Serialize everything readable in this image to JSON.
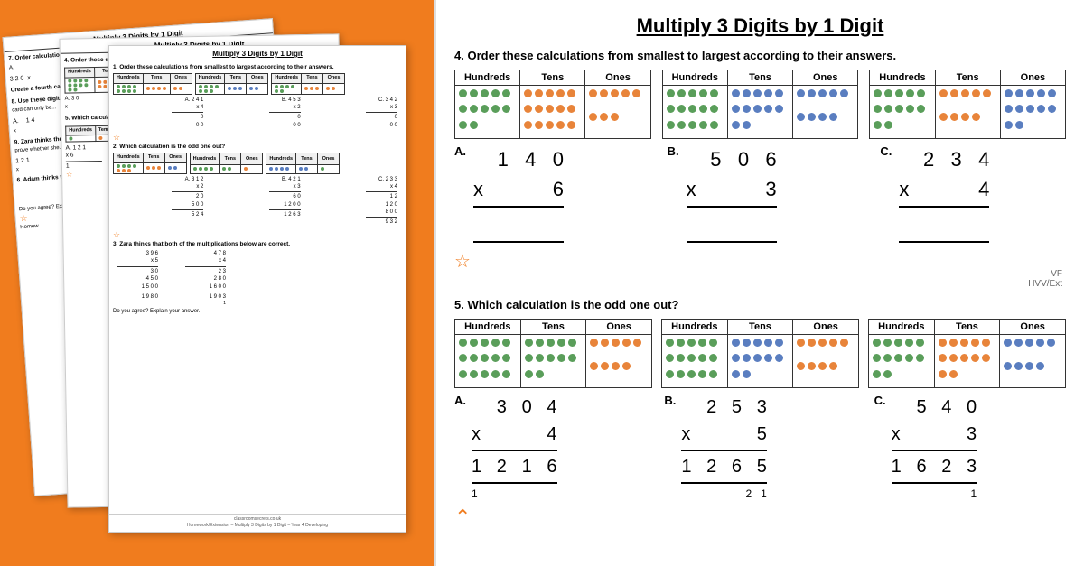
{
  "leftPanel": {
    "worksheets": [
      {
        "id": "back",
        "title": "Multiply 3 Digits by 1 Digit",
        "questions": [
          "7. Order calculations A, B and C from largest to smallest according to their answers.",
          "Create a fourth ca...",
          "8. Use these digit...",
          "card can only be...",
          "9. Zara thinks the...",
          "prove whether she...",
          "6. Adam thinks tha...",
          "Do you agree? Exp...",
          "Homew..."
        ]
      },
      {
        "id": "mid",
        "title": "Multiply 3 Digits by 1 Digit",
        "questions": [
          "4. Order these calculations from smallest to largest according to their answers.",
          "5. Which calculatio...",
          "A.  3 0",
          "x",
          "Hundreds  Tens",
          "A.  1 2  1",
          "x  6",
          "1"
        ]
      },
      {
        "id": "front",
        "title": "Multiply 3 Digits by 1 Digit",
        "sections": [
          {
            "num": "1.",
            "text": "Order these calculations from smallest to largest according to their answers.",
            "calcs": [
              {
                "label": "A.",
                "nums": [
                  "2 4 1",
                  "x  4"
                ],
                "result": [
                  "0",
                  "0 0"
                ]
              },
              {
                "label": "B.",
                "nums": [
                  "4 5 3",
                  "x  2"
                ],
                "result": [
                  "0",
                  "0 0"
                ]
              },
              {
                "label": "C.",
                "nums": [
                  "3 4 2",
                  "x  3"
                ],
                "result": [
                  "0",
                  "0 0"
                ]
              }
            ]
          },
          {
            "num": "2.",
            "text": "Which calculation is the odd one out?"
          },
          {
            "num": "3.",
            "text": "Zara thinks that both of the multiplications below are correct.",
            "calcs": [
              {
                "nums": [
                  "3 9 6",
                  "x    5",
                  "3 0",
                  "4 5 0",
                  "1 5 0 0",
                  "1 9 8 0"
                ]
              },
              {
                "nums": [
                  "4 7 8",
                  "x      4",
                  "2 3",
                  "2 8 0",
                  "1 6 0 0",
                  "1 9 0 3"
                ]
              }
            ]
          }
        ],
        "footer": "classroomsecrets.co.uk",
        "footerSub": "Homework/Extension – Multiply 3 Digits by 1 Digit – Year 4 Developing"
      }
    ]
  },
  "rightPanel": {
    "title": "Multiply 3 Digits by 1 Digit",
    "section4": {
      "label": "4.",
      "text": "Order these calculations from smallest to largest according to their answers.",
      "tables": [
        {
          "cols": [
            "Hundreds",
            "Tens",
            "Ones"
          ],
          "dots": [
            {
              "color": "green",
              "count": 12
            },
            {
              "color": "orange",
              "count": 15
            },
            {
              "color": "orange",
              "count": 8
            }
          ]
        },
        {
          "cols": [
            "Hundreds",
            "Tens",
            "Ones"
          ],
          "dots": [
            {
              "color": "green",
              "count": 15
            },
            {
              "color": "blue",
              "count": 12
            },
            {
              "color": "blue",
              "count": 9
            }
          ]
        },
        {
          "cols": [
            "Hundreds",
            "Tens",
            "Ones"
          ],
          "dots": [
            {
              "color": "green",
              "count": 12
            },
            {
              "color": "orange",
              "count": 9
            },
            {
              "color": "blue",
              "count": 12
            }
          ]
        }
      ],
      "calculations": [
        {
          "label": "A.",
          "top": "1  4  0",
          "operator": "x",
          "multiplier": "6",
          "result": ""
        },
        {
          "label": "B.",
          "top": "5  0  6",
          "operator": "x",
          "multiplier": "3",
          "result": ""
        },
        {
          "label": "C.",
          "top": "2  3  4",
          "operator": "x",
          "multiplier": "4",
          "result": ""
        }
      ]
    },
    "section5": {
      "label": "5.",
      "text": "Which calculation is the odd one out?",
      "tables": [
        {
          "cols": [
            "Hundreds",
            "Tens",
            "Ones"
          ],
          "dots": [
            {
              "color": "green",
              "count": 15
            },
            {
              "color": "green",
              "count": 12
            },
            {
              "color": "orange",
              "count": 9
            }
          ]
        },
        {
          "cols": [
            "Hundreds",
            "Tens",
            "Ones"
          ],
          "dots": [
            {
              "color": "green",
              "count": 15
            },
            {
              "color": "blue",
              "count": 12
            },
            {
              "color": "orange",
              "count": 9
            }
          ]
        },
        {
          "cols": [
            "Hundreds",
            "Tens",
            "Ones"
          ],
          "dots": [
            {
              "color": "green",
              "count": 12
            },
            {
              "color": "orange",
              "count": 12
            },
            {
              "color": "blue",
              "count": 9
            }
          ]
        }
      ],
      "calculations": [
        {
          "label": "A.",
          "top": "3  0  4",
          "operator": "x",
          "multiplier": "4",
          "result": "1  2  1  6"
        },
        {
          "label": "B.",
          "top": "2  5  3",
          "operator": "x",
          "multiplier": "5",
          "result": "1  2  6  5"
        },
        {
          "label": "C.",
          "top": "5  4  0",
          "operator": "x",
          "multiplier": "3",
          "result": "1  6  2  3"
        }
      ],
      "resultRow2": [
        "1",
        "2  1",
        "1"
      ]
    },
    "vfBadge": "VF\nHVV/Ext",
    "bottomArrow": "⌃"
  }
}
